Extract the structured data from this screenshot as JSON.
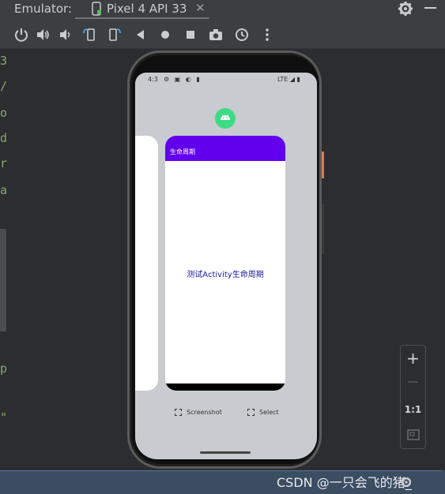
{
  "titlebar": {
    "title": "Emulator:",
    "tab_label": "Pixel 4 API 33",
    "close_glyph": "✕"
  },
  "toolbar": {
    "buttons": [
      "power",
      "volume-up",
      "volume-down",
      "rotate-left",
      "rotate-right",
      "back",
      "home",
      "overview",
      "screenshot",
      "snapshot",
      "more"
    ]
  },
  "editor_gutter": {
    "chars": [
      "3",
      "/",
      "o",
      "d",
      "r",
      "a",
      "p",
      "\""
    ]
  },
  "phone": {
    "statusbar": {
      "time": "4:3",
      "icons": "⚙ ▣ ◐ ▮",
      "network": "LTE ◢ ▮"
    },
    "app_card": {
      "title": "生命周期",
      "body_text": "测试Activity生命周期"
    },
    "actions": {
      "screenshot": "Screenshot",
      "select": "Select"
    }
  },
  "zoom_panel": {
    "zoom_in": "+",
    "zoom_out": "—",
    "fit": "1:1"
  },
  "watermark": "CSDN @一只会飞的猪_",
  "colors": {
    "accent": "#6200ee",
    "app_icon": "#3ddc84",
    "body_text": "#1a1aa8"
  }
}
